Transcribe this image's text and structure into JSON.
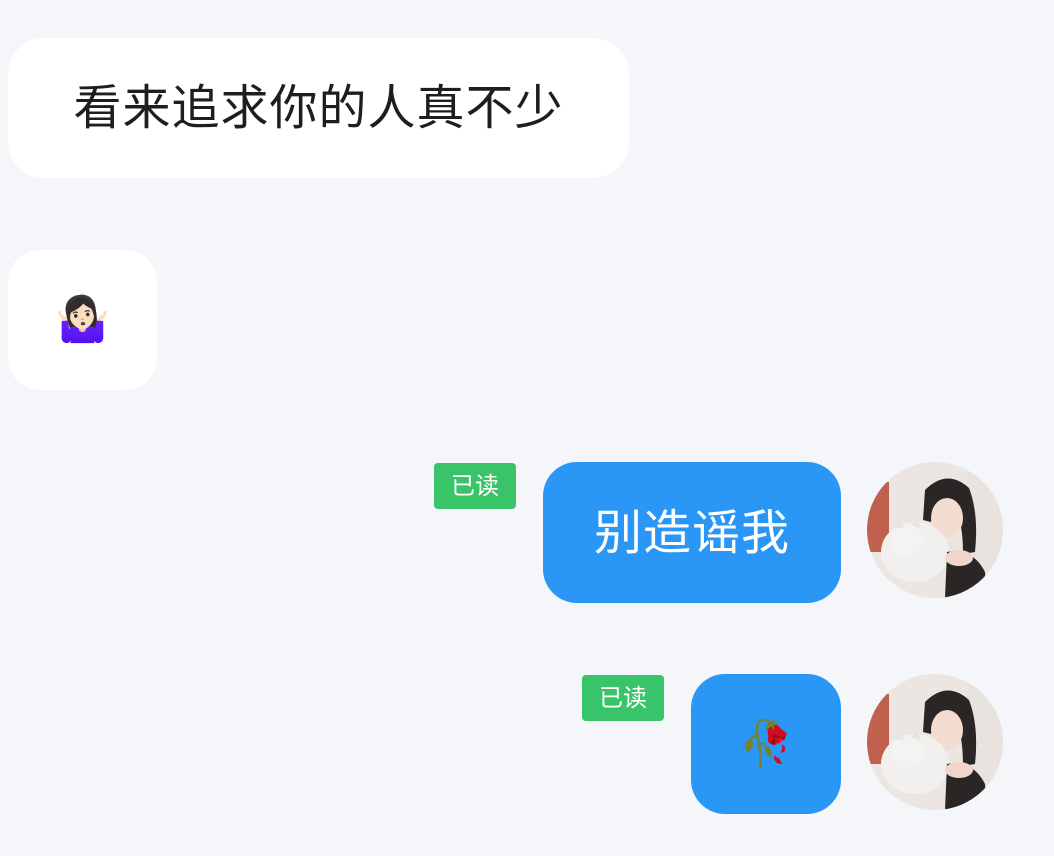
{
  "messages": [
    {
      "side": "incoming",
      "type": "text",
      "text": "看来追求你的人真不少"
    },
    {
      "side": "incoming",
      "type": "emoji",
      "emoji": "🤷🏻‍♀️",
      "icon": "woman-shrugging-icon"
    },
    {
      "side": "outgoing",
      "type": "text",
      "text": "别造谣我",
      "status": "已读"
    },
    {
      "side": "outgoing",
      "type": "emoji",
      "emoji": "🥀",
      "icon": "wilted-flower-icon",
      "status": "已读"
    }
  ],
  "colors": {
    "background": "#f4f6f9",
    "incoming_bubble": "#ffffff",
    "outgoing_bubble": "#2a97f7",
    "read_badge": "#39c46a"
  }
}
